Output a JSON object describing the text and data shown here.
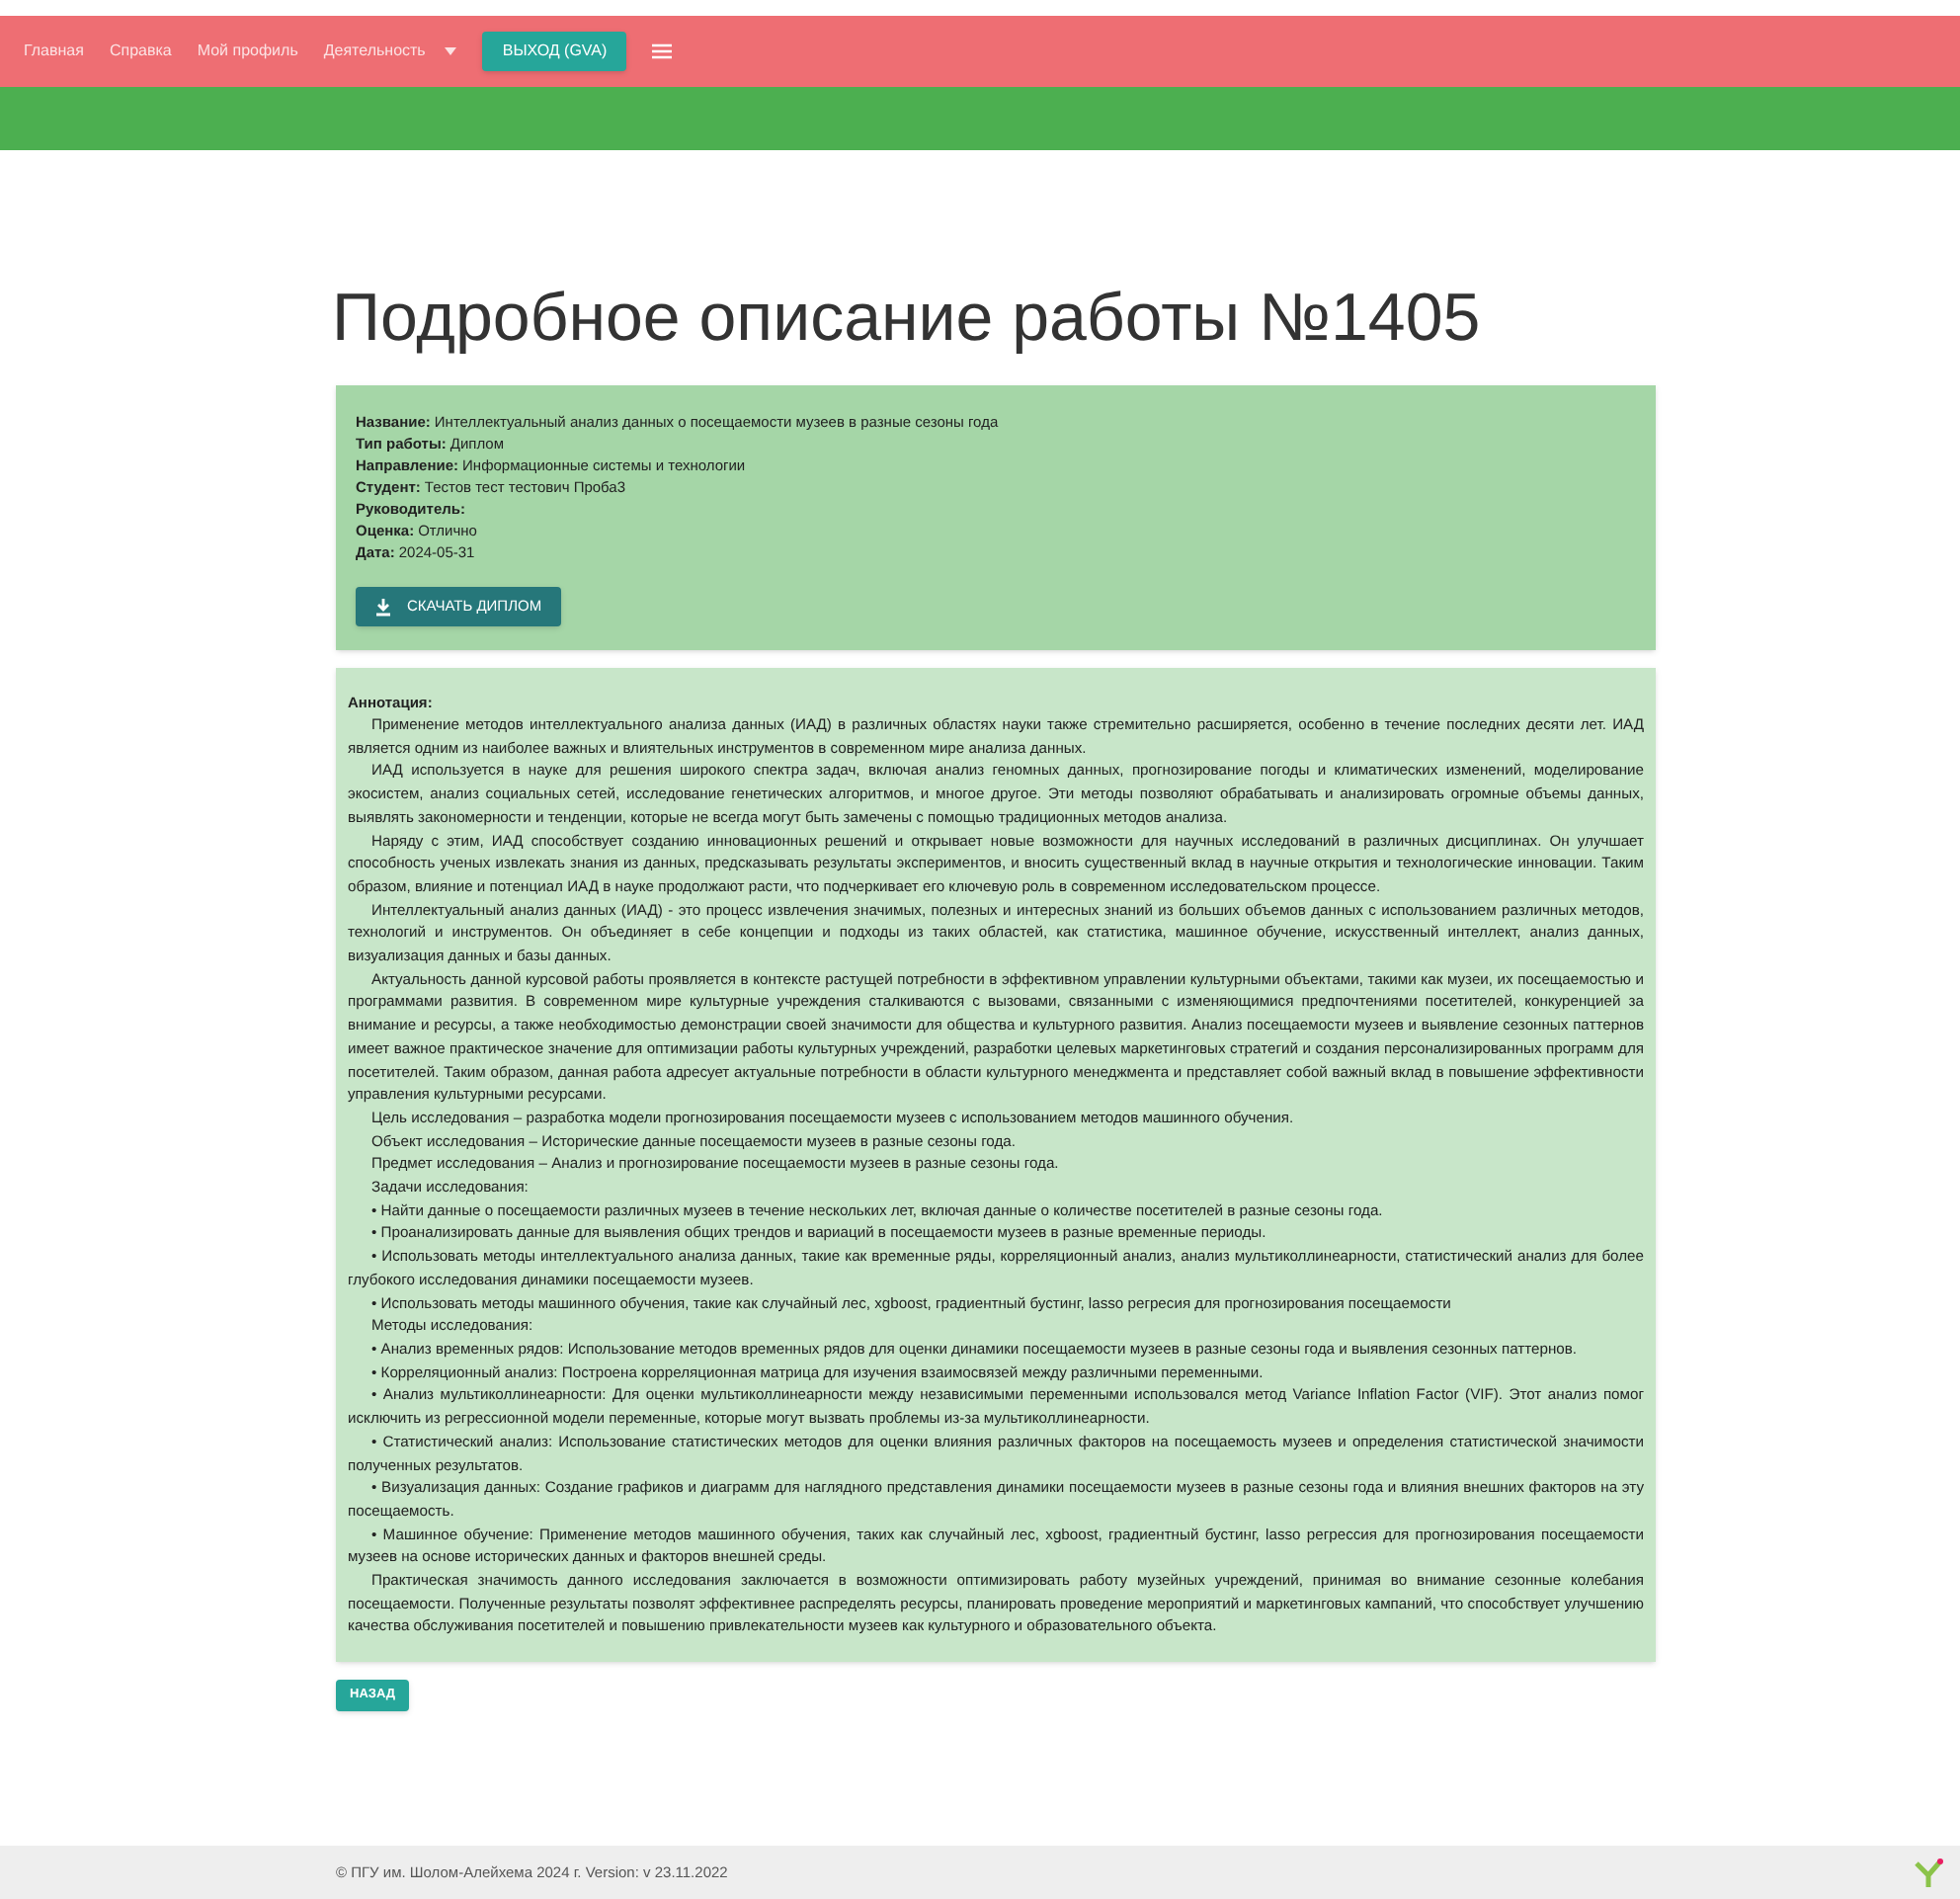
{
  "nav": {
    "links": [
      "Главная",
      "Справка",
      "Мой профиль",
      "Деятельность"
    ],
    "logout": "ВЫХОД (GVA)"
  },
  "title": "Подробное описание работы №1405",
  "info": {
    "fields": [
      {
        "label": "Название:",
        "value": "Интеллектуальный анализ данных о посещаемости музеев в разные сезоны года"
      },
      {
        "label": "Тип работы:",
        "value": "Диплом"
      },
      {
        "label": "Направление:",
        "value": "Информационные системы и технологии"
      },
      {
        "label": "Студент:",
        "value": "Тестов тест тестович Проба3"
      },
      {
        "label": "Руководитель:"
      },
      {
        "label": "Оценка:",
        "value": "Отлично"
      },
      {
        "label": "Дата:",
        "value": "2024-05-31"
      }
    ],
    "download": "СКАЧАТЬ ДИПЛОМ"
  },
  "annotation": {
    "heading": "Аннотация:",
    "paragraphs": [
      "Применение методов интеллектуального анализа данных (ИАД) в различных областях науки также стремительно расширяется, особенно в течение последних десяти лет. ИАД является одним из наиболее важных и влиятельных инструментов в современном мире анализа данных.",
      "ИАД используется в науке для решения широкого спектра задач, включая анализ геномных данных, прогнозирование погоды и климатических изменений, моделирование экосистем, анализ социальных сетей, исследование генетических алгоритмов, и многое другое. Эти методы позволяют обрабатывать и анализировать огромные объемы данных, выявлять закономерности и тенденции, которые не всегда могут быть замечены с помощью традиционных методов анализа.",
      "Наряду с этим, ИАД способствует созданию инновационных решений и открывает новые возможности для научных исследований в различных дисциплинах. Он улучшает способность ученых извлекать знания из данных, предсказывать результаты экспериментов, и вносить существенный вклад в научные открытия и технологические инновации. Таким образом, влияние и потенциал ИАД в науке продолжают расти, что подчеркивает его ключевую роль в современном исследовательском процессе.",
      "Интеллектуальный анализ данных (ИАД) - это процесс извлечения значимых, полезных и интересных знаний из больших объемов данных с использованием различных методов, технологий и инструментов. Он объединяет в себе концепции и подходы из таких областей, как статистика, машинное обучение, искусственный интеллект, анализ данных, визуализация данных и базы данных.",
      "Актуальность данной курсовой работы проявляется в контексте растущей потребности в эффективном управлении культурными объектами, такими как музеи, их посещаемостью и программами развития. В современном мире культурные учреждения сталкиваются с вызовами, связанными с изменяющимися предпочтениями посетителей, конкуренцией за внимание и ресурсы, а также необходимостью демонстрации своей значимости для общества и культурного развития. Анализ посещаемости музеев и выявление сезонных паттернов имеет важное практическое значение для оптимизации работы культурных учреждений, разработки целевых маркетинговых стратегий и создания персонализированных программ для посетителей. Таким образом, данная работа адресует актуальные потребности в области культурного менеджмента и представляет собой важный вклад в повышение эффективности управления культурными ресурсами.",
      "Цель исследования – разработка модели прогнозирования посещаемости музеев с использованием методов машинного обучения.",
      "Объект исследования – Исторические данные посещаемости музеев в разные сезоны года.",
      "Предмет исследования – Анализ и прогнозирование посещаемости музеев в разные сезоны года.",
      "Задачи исследования:",
      "• Найти данные о посещаемости различных музеев в течение нескольких лет, включая данные о количестве посетителей в разные сезоны года.",
      "• Проанализировать данные для выявления общих трендов и вариаций в посещаемости музеев в разные временные периоды.",
      "• Использовать методы интеллектуального анализа данных, такие как временные ряды, корреляционный анализ, анализ мультиколлинеарности, статистический анализ для более глубокого исследования динамики посещаемости музеев.",
      "• Использовать методы машинного обучения, такие как случайный лес, xgboost, градиентный бустинг, lasso регресия для прогнозирования посещаемости",
      "Методы исследования:",
      "• Анализ временных рядов: Использование методов временных рядов для оценки динамики посещаемости музеев в разные сезоны года и выявления сезонных паттернов.",
      "• Корреляционный анализ: Построена корреляционная матрица для изучения взаимосвязей между различными переменными.",
      "• Анализ мультиколлинеарности: Для оценки мультиколлинеарности между независимыми переменными использовался метод Variance Inflation Factor (VIF). Этот анализ помог исключить из регрессионной модели переменные, которые могут вызвать проблемы из-за мультиколлинеарности.",
      "• Статистический анализ: Использование статистических методов для оценки влияния различных факторов на посещаемость музеев и определения статистической значимости полученных результатов.",
      "• Визуализация данных: Создание графиков и диаграмм для наглядного представления динамики посещаемости музеев в разные сезоны года и влияния внешних факторов на эту посещаемость.",
      "• Машинное обучение: Применение методов машинного обучения, таких как случайный лес, xgboost, градиентный бустинг, lasso регрессия для прогнозирования посещаемости музеев на основе исторических данных и факторов внешней среды.",
      "Практическая значимость данного исследования заключается в возможности оптимизировать работу музейных учреждений, принимая во внимание сезонные колебания посещаемости. Полученные результаты позволят эффективнее распределять ресурсы, планировать проведение мероприятий и маркетинговых кампаний, что способствует улучшению качества обслуживания посетителей и повышению привлекательности музеев как культурного и образовательного объекта."
    ]
  },
  "back": "НАЗАД",
  "footer": "© ПГУ им. Шолом-Алейхема 2024 г. Version: v 23.11.2022"
}
